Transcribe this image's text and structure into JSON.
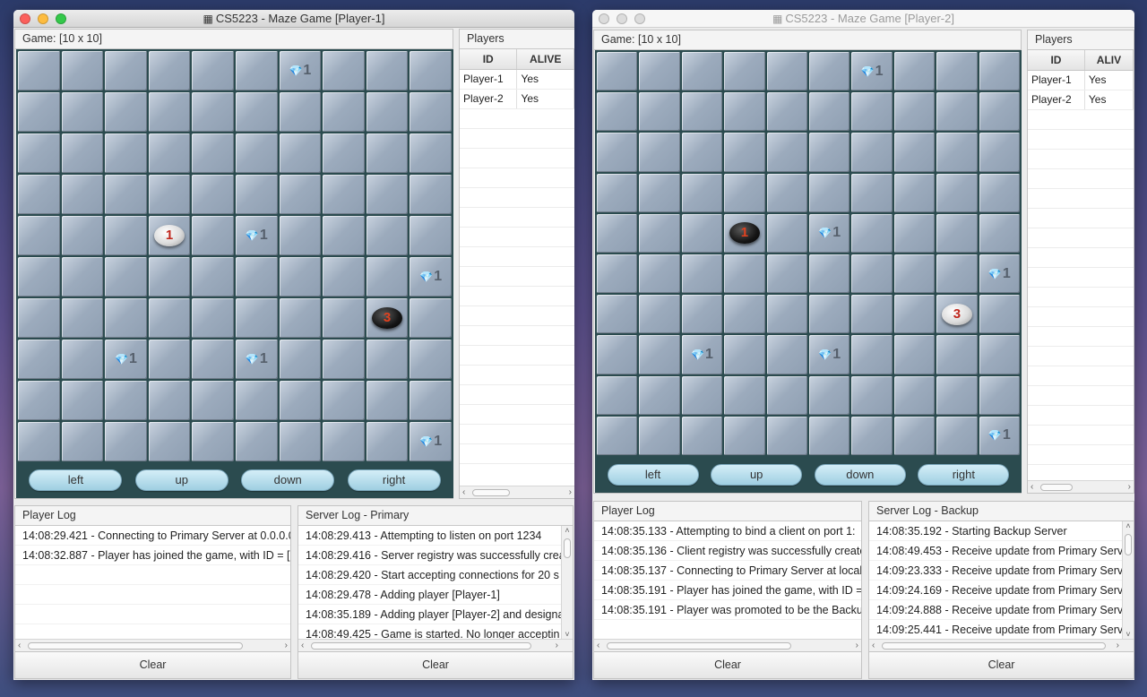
{
  "windows": [
    {
      "title": "CS5223 - Maze Game [Player-1]",
      "active": true,
      "game_title": "Game: [10 x 10]",
      "players_title": "Players",
      "players_headers": [
        "ID",
        "ALIVE"
      ],
      "players": [
        {
          "id": "Player-1",
          "alive": "Yes"
        },
        {
          "id": "Player-2",
          "alive": "Yes"
        }
      ],
      "controls": [
        "left",
        "up",
        "down",
        "right"
      ],
      "cells": [
        {
          "row": 0,
          "col": 6,
          "kind": "treasure",
          "label": "1"
        },
        {
          "row": 4,
          "col": 3,
          "kind": "player-white",
          "label": "1"
        },
        {
          "row": 4,
          "col": 5,
          "kind": "treasure",
          "label": "1"
        },
        {
          "row": 5,
          "col": 9,
          "kind": "treasure",
          "label": "1"
        },
        {
          "row": 6,
          "col": 8,
          "kind": "player-black",
          "label": "3"
        },
        {
          "row": 7,
          "col": 2,
          "kind": "treasure",
          "label": "1"
        },
        {
          "row": 7,
          "col": 5,
          "kind": "treasure",
          "label": "1"
        },
        {
          "row": 9,
          "col": 9,
          "kind": "treasure",
          "label": "1"
        }
      ],
      "player_log_title": "Player Log",
      "player_log": [
        "14:08:29.421 - Connecting to Primary Server at 0.0.0.0",
        "14:08:32.887 - Player has joined the game, with ID = [P"
      ],
      "server_log_title": "Server Log - Primary",
      "server_log": [
        "14:08:29.413 - Attempting to listen on port 1234",
        "14:08:29.416 - Server registry was successfully crea",
        "14:08:29.420 - Start accepting connections for 20 s",
        "14:08:29.478 - Adding player [Player-1]",
        "14:08:35.189 - Adding player [Player-2] and designa",
        "14:08:49.425 - Game is started. No longer acceptin"
      ],
      "clear_label": "Clear"
    },
    {
      "title": "CS5223 - Maze Game [Player-2]",
      "active": false,
      "game_title": "Game: [10 x 10]",
      "players_title": "Players",
      "players_headers": [
        "ID",
        "ALIV"
      ],
      "players": [
        {
          "id": "Player-1",
          "alive": "Yes"
        },
        {
          "id": "Player-2",
          "alive": "Yes"
        }
      ],
      "controls": [
        "left",
        "up",
        "down",
        "right"
      ],
      "cells": [
        {
          "row": 0,
          "col": 6,
          "kind": "treasure",
          "label": "1"
        },
        {
          "row": 4,
          "col": 3,
          "kind": "player-black",
          "label": "1"
        },
        {
          "row": 4,
          "col": 5,
          "kind": "treasure",
          "label": "1"
        },
        {
          "row": 5,
          "col": 9,
          "kind": "treasure",
          "label": "1"
        },
        {
          "row": 6,
          "col": 8,
          "kind": "player-white",
          "label": "3"
        },
        {
          "row": 7,
          "col": 2,
          "kind": "treasure",
          "label": "1"
        },
        {
          "row": 7,
          "col": 5,
          "kind": "treasure",
          "label": "1"
        },
        {
          "row": 9,
          "col": 9,
          "kind": "treasure",
          "label": "1"
        }
      ],
      "player_log_title": "Player Log",
      "player_log": [
        "14:08:35.133 - Attempting to bind a client on port 1:",
        "14:08:35.136 - Client registry was successfully create",
        "14:08:35.137 - Connecting to Primary Server at localh",
        "14:08:35.191 - Player has joined the game, with ID = [",
        "14:08:35.191 - Player was promoted to be the Backup"
      ],
      "server_log_title": "Server Log - Backup",
      "server_log": [
        "14:08:35.192 - Starting Backup Server",
        "14:08:49.453 - Receive update from Primary Serv",
        "14:09:23.333 - Receive update from Primary Serv",
        "14:09:24.169 - Receive update from Primary Serv",
        "14:09:24.888 - Receive update from Primary Serv",
        "14:09:25.441 - Receive update from Primary Serv"
      ],
      "clear_label": "Clear"
    }
  ]
}
